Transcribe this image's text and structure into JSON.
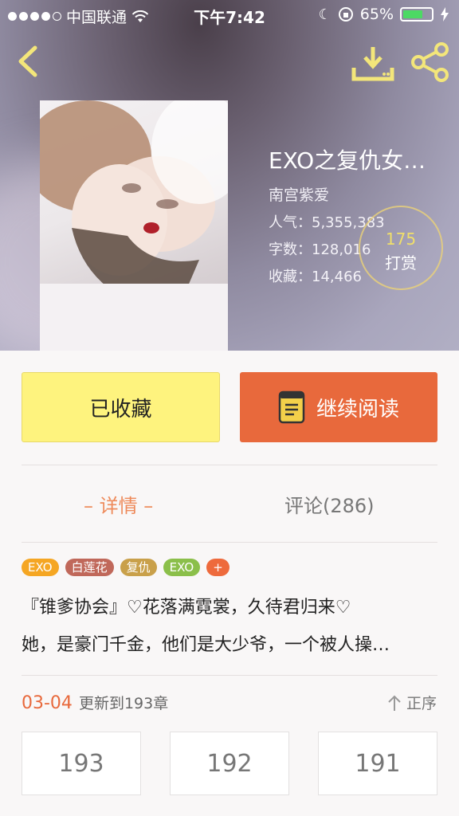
{
  "status_bar": {
    "carrier": "中国联通",
    "time": "下午7:42",
    "battery": "65%",
    "battery_level": 0.65
  },
  "book": {
    "title": "EXO之复仇女…",
    "author": "南宫紫爱",
    "popularity": "人气：5,355,383",
    "word_count": "字数：128,016",
    "favorites": "收藏：14,466",
    "reward_count": "175",
    "reward_label": "打赏"
  },
  "actions": {
    "favorite_label": "已收藏",
    "read_label": "继续阅读"
  },
  "tabs": {
    "detail": "– 详情 –",
    "comments": "评论(286)"
  },
  "tags": [
    {
      "label": "EXO",
      "color": "#f5a623"
    },
    {
      "label": "白莲花",
      "color": "#c0685a"
    },
    {
      "label": "复仇",
      "color": "#c9a04a"
    },
    {
      "label": "EXO",
      "color": "#8bbf4a"
    },
    {
      "label": "+",
      "color": "#ee6a3c"
    }
  ],
  "description": {
    "line1": "『锥爹协会』♡花落满霓裳，久待君归来♡",
    "line2": "她，是豪门千金，他们是大少爷，一个被人操…"
  },
  "update": {
    "date": "03-04",
    "text": "更新到193章",
    "order_label": "正序"
  },
  "chapters": [
    "193",
    "192",
    "191"
  ],
  "colors": {
    "accent": "#e8693c",
    "favorite_button": "#fef37e",
    "reward_number": "#f0df6a"
  }
}
